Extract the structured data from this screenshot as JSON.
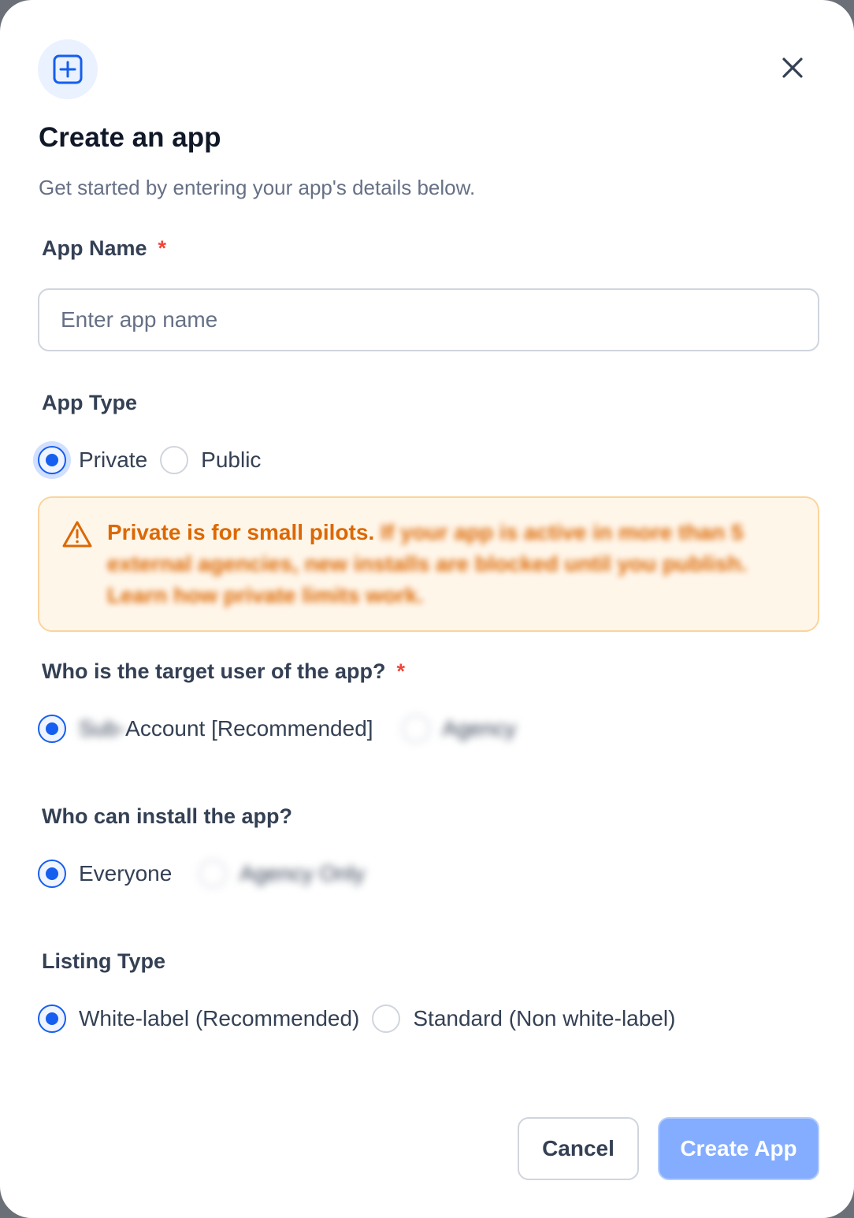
{
  "dialog": {
    "title": "Create an app",
    "subtitle": "Get started by entering your app's details below."
  },
  "app_name": {
    "label": "App Name",
    "required_mark": "*",
    "placeholder": "Enter app name",
    "value": ""
  },
  "app_type": {
    "label": "App Type",
    "options": [
      {
        "label": "Private",
        "selected": true
      },
      {
        "label": "Public",
        "selected": false
      }
    ]
  },
  "alert": {
    "heading": "Private is for small pilots.",
    "body": "If your app is active in more than 5 external agencies, new installs are blocked until you publish.",
    "link": "Learn how private limits work."
  },
  "target_user": {
    "label": "Who is the target user of the app?",
    "required_mark": "*",
    "options": [
      {
        "label_prefix": "Sub-",
        "label": "Account [Recommended]",
        "selected": true
      },
      {
        "label": "Agency",
        "selected": false
      }
    ]
  },
  "installers": {
    "label": "Who can install the app?",
    "options": [
      {
        "label": "Everyone",
        "selected": true
      },
      {
        "label": "Agency Only",
        "selected": false
      }
    ]
  },
  "listing_type": {
    "label": "Listing Type",
    "options": [
      {
        "label": "White-label (Recommended)",
        "selected": true
      },
      {
        "label": "Standard (Non white-label)",
        "selected": false
      }
    ]
  },
  "footer": {
    "cancel_label": "Cancel",
    "create_label": "Create App"
  },
  "colors": {
    "primary": "#155eef",
    "primary_disabled": "#84adff",
    "warning_text": "#dc6803",
    "warning_bg": "#fff6ea",
    "required": "#f04438"
  },
  "icons": {
    "header": "plus-square-icon",
    "close": "close-icon",
    "alert": "warning-triangle-icon"
  }
}
